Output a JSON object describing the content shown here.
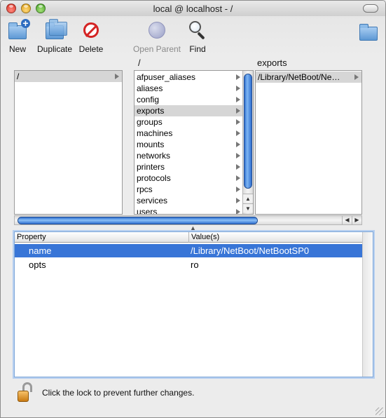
{
  "window": {
    "title": "local @ localhost - /"
  },
  "toolbar": {
    "new_label": "New",
    "duplicate_label": "Duplicate",
    "delete_label": "Delete",
    "open_parent_label": "Open Parent",
    "find_label": "Find"
  },
  "browser": {
    "col2_header": "/",
    "col3_header": "exports",
    "column1": [
      {
        "label": "/",
        "selected": true
      }
    ],
    "column2": [
      {
        "label": "afpuser_aliases"
      },
      {
        "label": "aliases"
      },
      {
        "label": "config"
      },
      {
        "label": "exports",
        "selected": true
      },
      {
        "label": "groups"
      },
      {
        "label": "machines"
      },
      {
        "label": "mounts"
      },
      {
        "label": "networks"
      },
      {
        "label": "printers"
      },
      {
        "label": "protocols"
      },
      {
        "label": "rpcs"
      },
      {
        "label": "services"
      },
      {
        "label": "users"
      }
    ],
    "column3": [
      {
        "label": "/Library/NetBoot/Ne…",
        "selected": true
      }
    ]
  },
  "table": {
    "headers": [
      "Property",
      "Value(s)"
    ],
    "rows": [
      {
        "property": "name",
        "value": "/Library/NetBoot/NetBootSP0",
        "selected": true
      },
      {
        "property": "opts",
        "value": "ro",
        "selected": false
      }
    ]
  },
  "lock": {
    "message": "Click the lock to prevent further changes."
  },
  "colors": {
    "selection": "#3875d7",
    "scroll_thumb": "#4a8be0"
  }
}
